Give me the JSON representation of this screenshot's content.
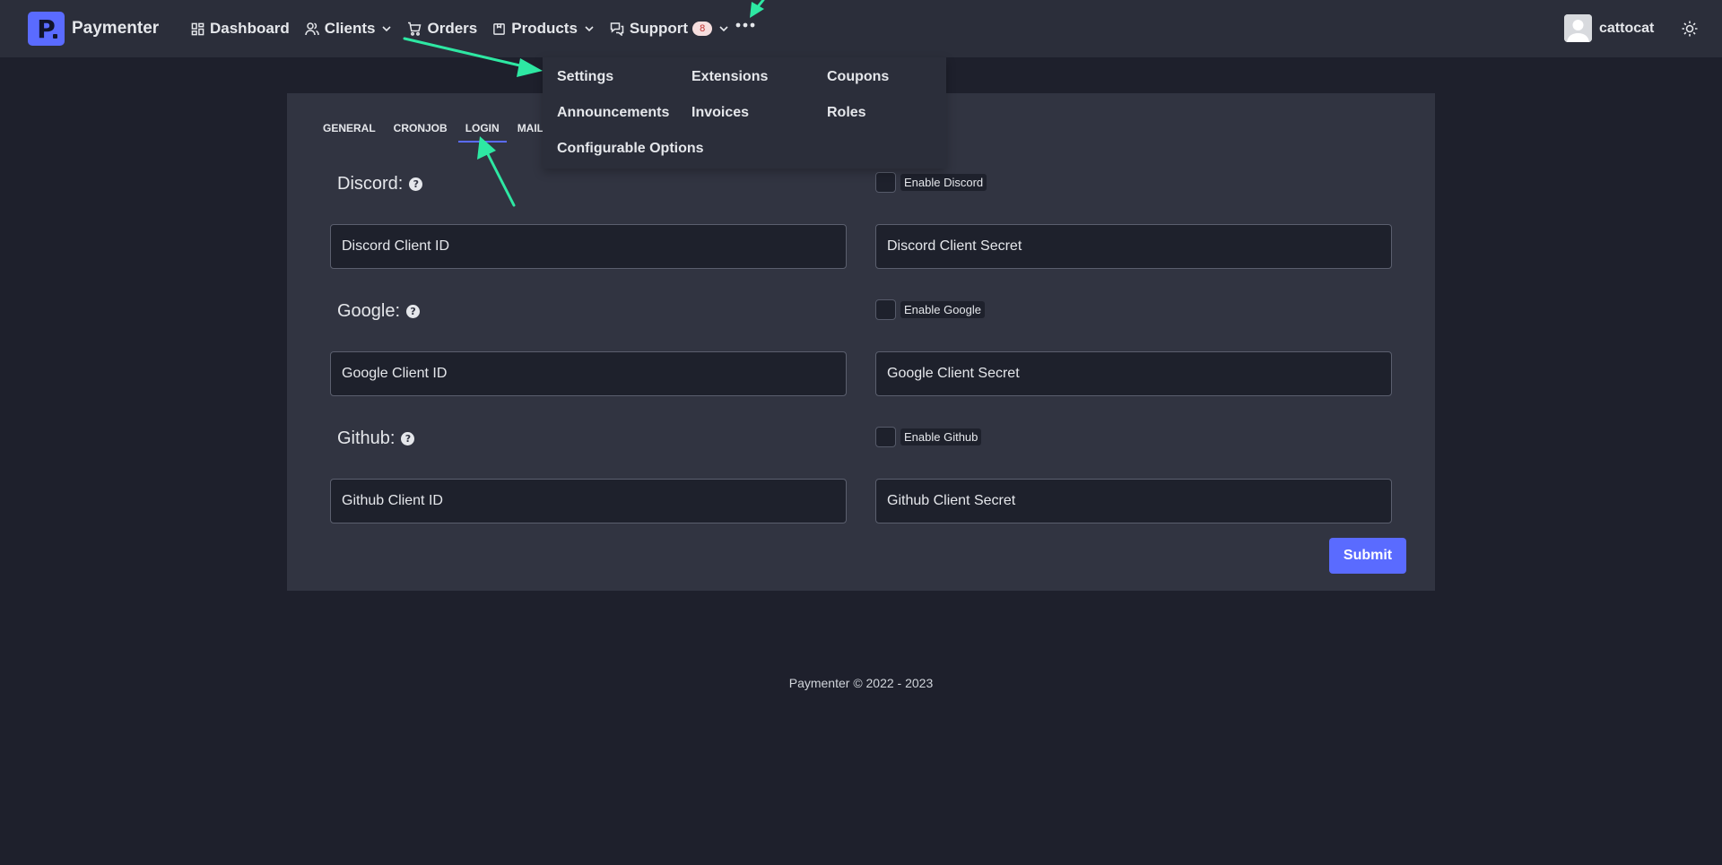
{
  "app": {
    "brand": "Paymenter",
    "logo_letter": "P"
  },
  "nav": {
    "items": [
      {
        "label": "Dashboard",
        "icon": "dashboard-icon"
      },
      {
        "label": "Clients",
        "icon": "users-icon",
        "dropdown": true
      },
      {
        "label": "Orders",
        "icon": "cart-icon"
      },
      {
        "label": "Products",
        "icon": "box-icon",
        "dropdown": true
      },
      {
        "label": "Support",
        "icon": "chat-icon",
        "badge": "8",
        "dropdown": true
      }
    ],
    "more_icon": "more-dots-icon"
  },
  "user": {
    "name": "cattocat",
    "avatar_icon": "user-avatar-icon",
    "theme_icon": "sun-icon"
  },
  "dropdown": {
    "items": [
      "Settings",
      "Extensions",
      "Coupons",
      "Announcements",
      "Invoices",
      "Roles",
      "Configurable Options"
    ]
  },
  "settings": {
    "tabs": [
      "GENERAL",
      "CRONJOB",
      "LOGIN",
      "MAIL"
    ],
    "active_tab": "LOGIN",
    "sections": [
      {
        "title": "Discord:",
        "enable_label": "Enable Discord",
        "client_id_placeholder": "Discord Client ID",
        "client_secret_placeholder": "Discord Client Secret"
      },
      {
        "title": "Google:",
        "enable_label": "Enable Google",
        "client_id_placeholder": "Google Client ID",
        "client_secret_placeholder": "Google Client Secret"
      },
      {
        "title": "Github:",
        "enable_label": "Enable Github",
        "client_id_placeholder": "Github Client ID",
        "client_secret_placeholder": "Github Client Secret"
      }
    ],
    "help_glyph": "?",
    "submit_label": "Submit"
  },
  "footer": {
    "text": "Paymenter © 2022 - 2023"
  },
  "colors": {
    "accent": "#5a6bff",
    "annotation_arrow": "#2ee8a3",
    "badge_bg": "#f6dede",
    "badge_text": "#c03131"
  }
}
